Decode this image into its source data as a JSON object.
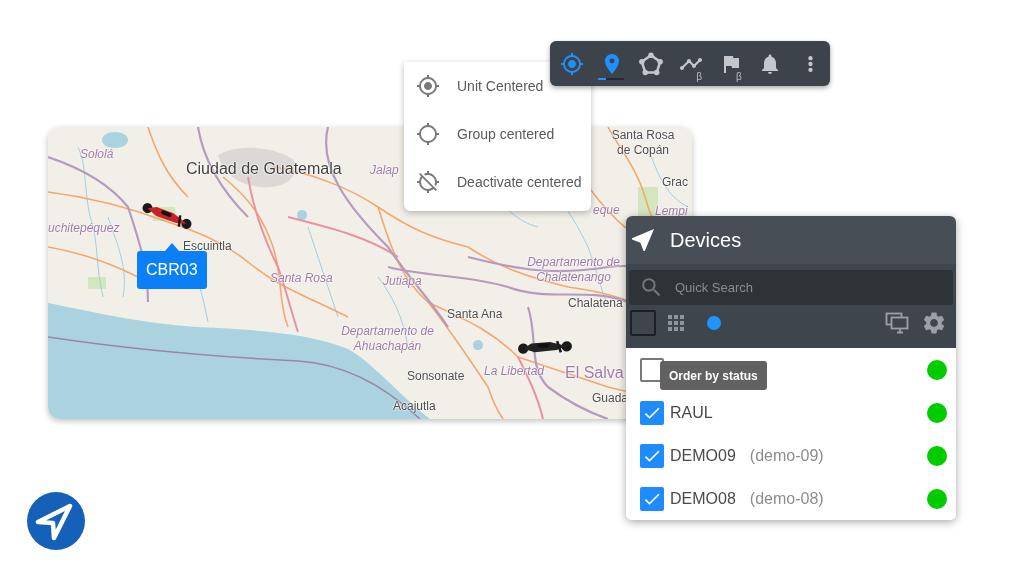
{
  "toolbar": {
    "tools": [
      {
        "selected": false,
        "highlighted": true
      },
      {
        "selected": true,
        "highlighted": true
      },
      {
        "selected": false,
        "highlighted": false
      },
      {
        "selected": false,
        "highlighted": false,
        "tag": "β"
      },
      {
        "selected": false,
        "highlighted": false,
        "tag": "β"
      },
      {
        "selected": false,
        "highlighted": false
      },
      {
        "selected": false,
        "highlighted": false
      }
    ]
  },
  "centering_menu": {
    "items": [
      {
        "label": "Unit Centered"
      },
      {
        "label": "Group centered"
      },
      {
        "label": "Deactivate centered"
      }
    ]
  },
  "map": {
    "labels": [
      {
        "text": "Sololá",
        "kind": "region"
      },
      {
        "text": "Santa Rosa de Copán",
        "kind": "city"
      },
      {
        "text": "Ciudad de Guatemala",
        "kind": "capital"
      },
      {
        "text": "Jalap",
        "kind": "region"
      },
      {
        "text": "Grac",
        "kind": "city"
      },
      {
        "text": "eque",
        "kind": "region"
      },
      {
        "text": "Lempi",
        "kind": "region"
      },
      {
        "text": "uchitepéquez",
        "kind": "region"
      },
      {
        "text": "Escuintla",
        "kind": "city"
      },
      {
        "text": "Santa Rosa",
        "kind": "region"
      },
      {
        "text": "Jutiapa",
        "kind": "region"
      },
      {
        "text": "Departamento de Chalatenango",
        "kind": "region"
      },
      {
        "text": "Santa Ana",
        "kind": "city"
      },
      {
        "text": "Chalatena",
        "kind": "city"
      },
      {
        "text": "Departamento de Ahuachapán",
        "kind": "region"
      },
      {
        "text": "Sonsonate",
        "kind": "city"
      },
      {
        "text": "La Libertad",
        "kind": "region"
      },
      {
        "text": "El Salva",
        "kind": "country"
      },
      {
        "text": "Acajutla",
        "kind": "city"
      },
      {
        "text": "Guada",
        "kind": "city"
      }
    ],
    "markers": [
      {
        "color": "#cc2027",
        "label": "CBR03"
      },
      {
        "color": "#222222"
      }
    ]
  },
  "devices_panel": {
    "title": "Devices",
    "search": {
      "placeholder": "Quick Search"
    },
    "select_all": {
      "checked": false
    },
    "tooltip": "Order by status",
    "devices": [
      {
        "checked": false,
        "online": true
      },
      {
        "name": "RAUL",
        "checked": true,
        "online": true
      },
      {
        "name": "DEMO09",
        "alias": "(demo-09)",
        "checked": true,
        "online": true
      },
      {
        "name": "DEMO08",
        "alias": "(demo-08)",
        "checked": true,
        "online": true
      }
    ]
  }
}
